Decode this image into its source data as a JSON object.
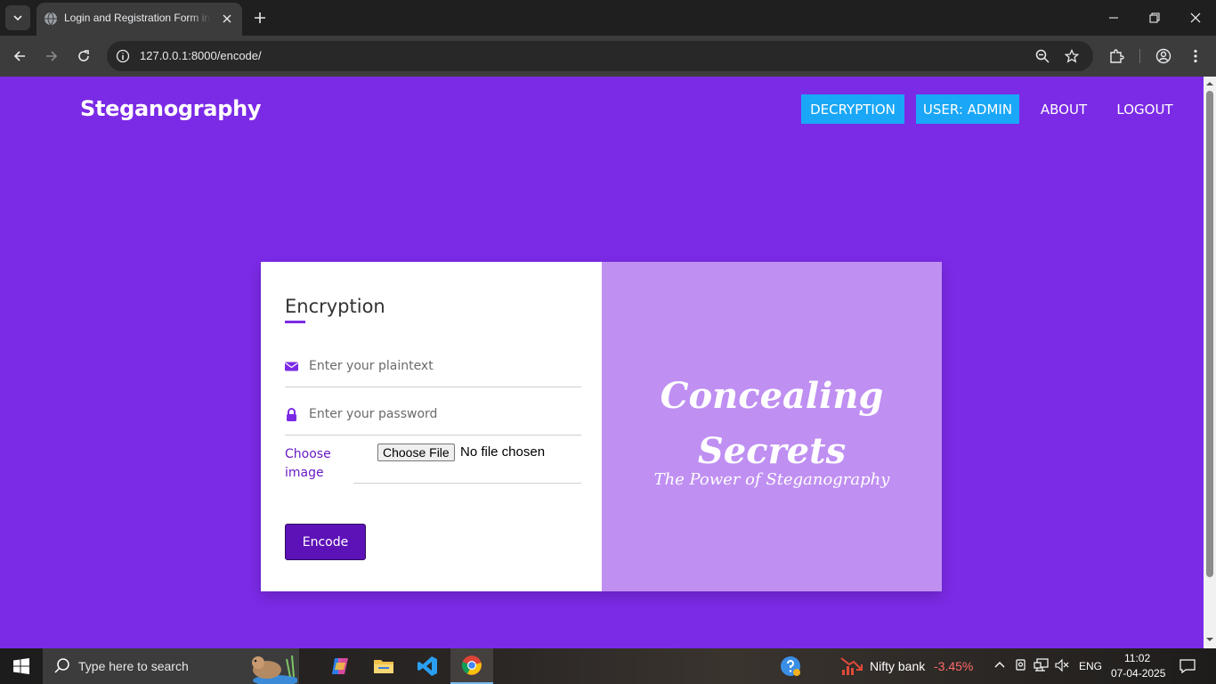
{
  "browser": {
    "tab_title": "Login and Registration Form in HTML",
    "url": "127.0.0.1:8000/encode/"
  },
  "page": {
    "brand": "Steganography",
    "nav": {
      "decryption": "DECRYPTION",
      "user": "USER: ADMIN",
      "about": "ABOUT",
      "logout": "LOGOUT"
    },
    "form": {
      "title": "Encryption",
      "plaintext_placeholder": "Enter your plaintext",
      "password_placeholder": "Enter your password",
      "choose_image_label": "Choose image",
      "file_button": "Choose File",
      "file_status": "No file chosen",
      "submit": "Encode"
    },
    "cover": {
      "title": "Concealing Secrets",
      "subtitle": "The Power of Steganography"
    }
  },
  "taskbar": {
    "search_placeholder": "Type here to search",
    "stock_name": "Nifty bank",
    "stock_change": "-3.45%",
    "language": "ENG",
    "time": "11:02",
    "date": "07-04-2025"
  },
  "colors": {
    "page_background": "#7b2ae6",
    "accent_button": "#1aa7f7",
    "encode_button": "#5d12b8",
    "cover_panel": "#bf8ff2",
    "stock_negative": "#ff6b6b"
  },
  "icons": {
    "plaintext_field": "envelope-icon",
    "password_field": "lock-icon"
  }
}
